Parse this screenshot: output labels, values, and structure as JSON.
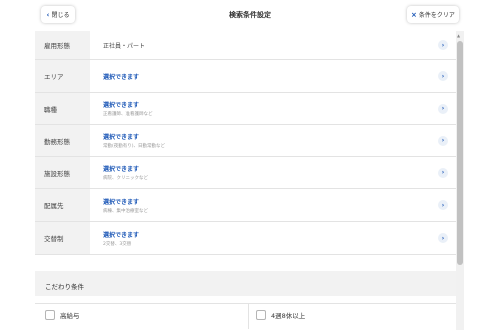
{
  "header": {
    "back_label": "閉じる",
    "back_icon": "chevron-left-icon",
    "title": "検索条件設定",
    "clear_label": "条件をクリア",
    "clear_icon": "close-icon"
  },
  "rows": [
    {
      "label": "雇用形態",
      "value": "正社員・パート",
      "hint": ""
    },
    {
      "label": "エリア",
      "value": "選択できます",
      "hint": ""
    },
    {
      "label": "職種",
      "value": "選択できます",
      "hint": "正看護師、准看護師など"
    },
    {
      "label": "勤務形態",
      "value": "選択できます",
      "hint": "常勤(夜勤有り)、日勤常勤など"
    },
    {
      "label": "施設形態",
      "value": "選択できます",
      "hint": "病院、クリニックなど"
    },
    {
      "label": "配属先",
      "value": "選択できます",
      "hint": "病棟、集中治療室など"
    },
    {
      "label": "交替制",
      "value": "選択できます",
      "hint": "2交替、3交替"
    }
  ],
  "kodawari": {
    "title": "こだわり条件",
    "options": [
      "高給与",
      "4週8休以上"
    ]
  },
  "colors": {
    "accent": "#1a56b6",
    "label_bg": "#f2f2f2",
    "border": "#e3e3e3"
  }
}
